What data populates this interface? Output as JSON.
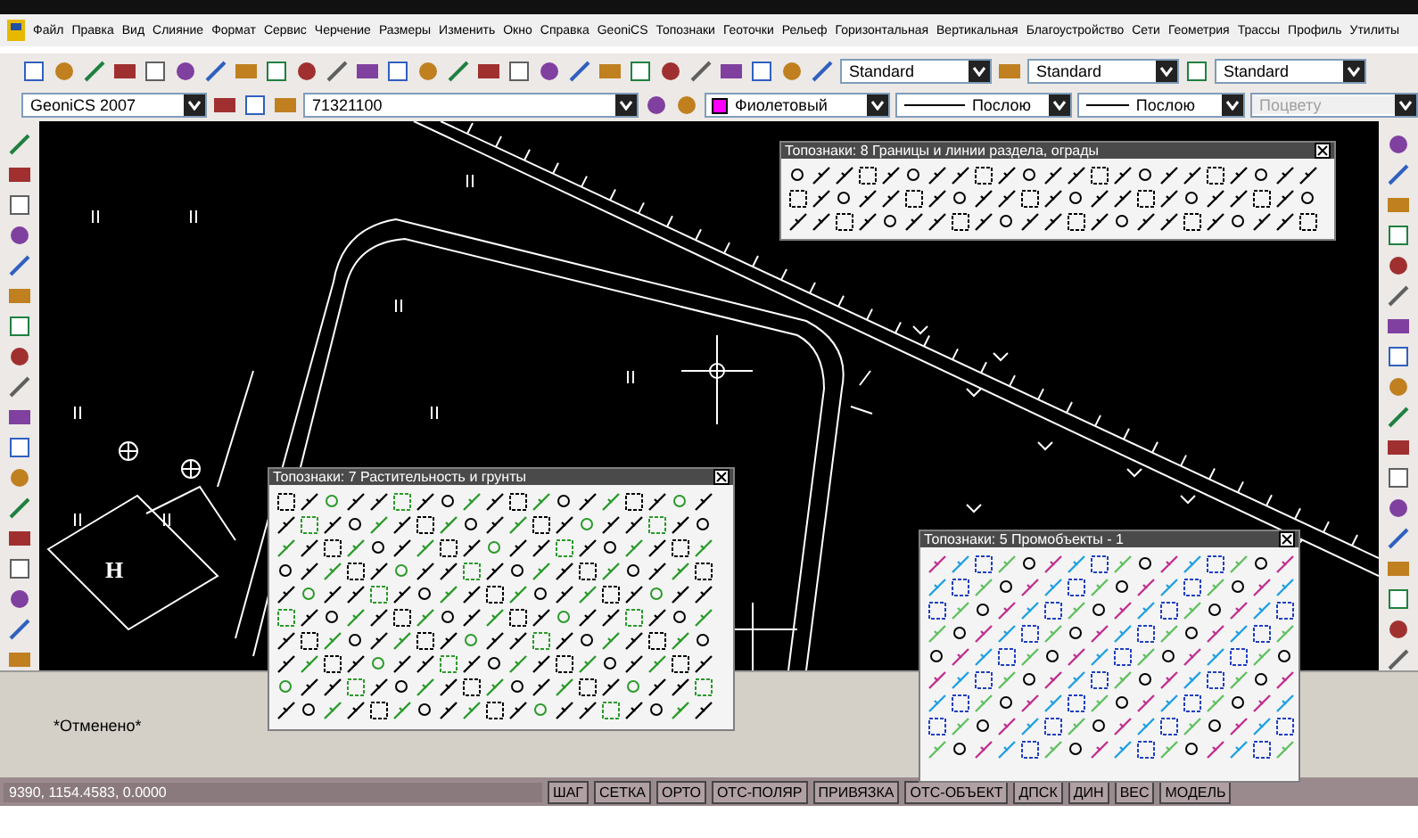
{
  "menu": [
    "Файл",
    "Правка",
    "Вид",
    "Слияние",
    "Формат",
    "Сервис",
    "Черчение",
    "Размеры",
    "Изменить",
    "Окно",
    "Справка",
    "GeoniCS",
    "Топознаки",
    "Геоточки",
    "Рельеф",
    "Горизонтальная",
    "Вертикальная",
    "Благоустройство",
    "Сети",
    "Геометрия",
    "Трассы",
    "Профиль",
    "Утилиты"
  ],
  "style_toolbar": {
    "text_style": "Standard",
    "dim_style": "Standard",
    "table_style": "Standard"
  },
  "layer_toolbar": {
    "workspace": "GeoniCS 2007",
    "layer": "71321100"
  },
  "properties_toolbar": {
    "color_name": "Фиолетовый",
    "linetype": "Послою",
    "lineweight": "Послою",
    "plot_style": {
      "value": "Поцвету",
      "disabled": true
    }
  },
  "drawing": {
    "building_label": "H"
  },
  "palettes": [
    {
      "title": "Топознаки: 8 Границы и линии раздела, ограды"
    },
    {
      "title": "Топознаки: 7 Растительность и грунты"
    },
    {
      "title": "Топознаки: 5 Промобъекты - 1"
    }
  ],
  "command_line": {
    "lines": [
      "*Отменено*"
    ]
  },
  "status_bar": {
    "coordinates": "9390, 1154.4583, 0.0000",
    "buttons": [
      "ШАГ",
      "СЕТКА",
      "ОРТО",
      "ОТС-ПОЛЯР",
      "ПРИВЯЗКА",
      "ОТС-ОБЪЕКТ",
      "ДПСК",
      "ДИН",
      "ВЕС",
      "МОДЕЛЬ"
    ]
  }
}
